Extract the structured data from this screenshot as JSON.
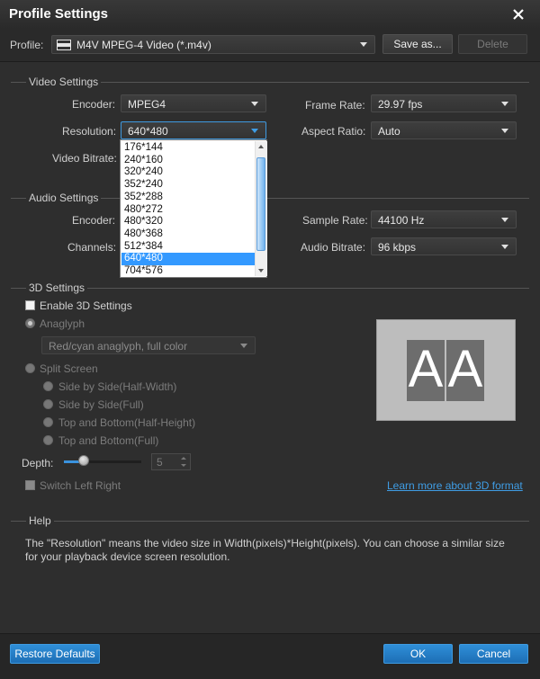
{
  "window": {
    "title": "Profile Settings"
  },
  "profile": {
    "label": "Profile:",
    "selected": "M4V MPEG-4 Video (*.m4v)",
    "save_as_label": "Save as...",
    "delete_label": "Delete"
  },
  "video": {
    "title": "Video Settings",
    "encoder_label": "Encoder:",
    "encoder_value": "MPEG4",
    "resolution_label": "Resolution:",
    "resolution_value": "640*480",
    "bitrate_label": "Video Bitrate:",
    "frame_rate_label": "Frame Rate:",
    "frame_rate_value": "29.97 fps",
    "aspect_ratio_label": "Aspect Ratio:",
    "aspect_ratio_value": "Auto",
    "resolution_options": [
      "176*144",
      "240*160",
      "320*240",
      "352*240",
      "352*288",
      "480*272",
      "480*320",
      "480*368",
      "512*384",
      "640*480",
      "704*576"
    ],
    "resolution_selected_index": 9
  },
  "audio": {
    "title": "Audio Settings",
    "encoder_label": "Encoder:",
    "channels_label": "Channels:",
    "sample_rate_label": "Sample Rate:",
    "sample_rate_value": "44100 Hz",
    "audio_bitrate_label": "Audio Bitrate:",
    "audio_bitrate_value": "96 kbps"
  },
  "three_d": {
    "title": "3D Settings",
    "enable_label": "Enable 3D Settings",
    "anaglyph_label": "Anaglyph",
    "anaglyph_value": "Red/cyan anaglyph, full color",
    "split_screen_label": "Split Screen",
    "split_options": [
      "Side by Side(Half-Width)",
      "Side by Side(Full)",
      "Top and Bottom(Half-Height)",
      "Top and Bottom(Full)"
    ],
    "depth_label": "Depth:",
    "depth_value": "5",
    "switch_label": "Switch Left Right",
    "learn_more_label": "Learn more about 3D format",
    "preview_letters": [
      "A",
      "A"
    ]
  },
  "help": {
    "title": "Help",
    "text": "The \"Resolution\" means the video size in Width(pixels)*Height(pixels).  You can choose a similar size for your playback device screen resolution."
  },
  "footer": {
    "restore_label": "Restore Defaults",
    "ok_label": "OK",
    "cancel_label": "Cancel"
  },
  "colors": {
    "accent": "#2f8fd8",
    "selection": "#3399ff",
    "link": "#3f9de5"
  },
  "icons": {
    "close": "close-icon",
    "profile_format": "m4v-format-icon"
  }
}
